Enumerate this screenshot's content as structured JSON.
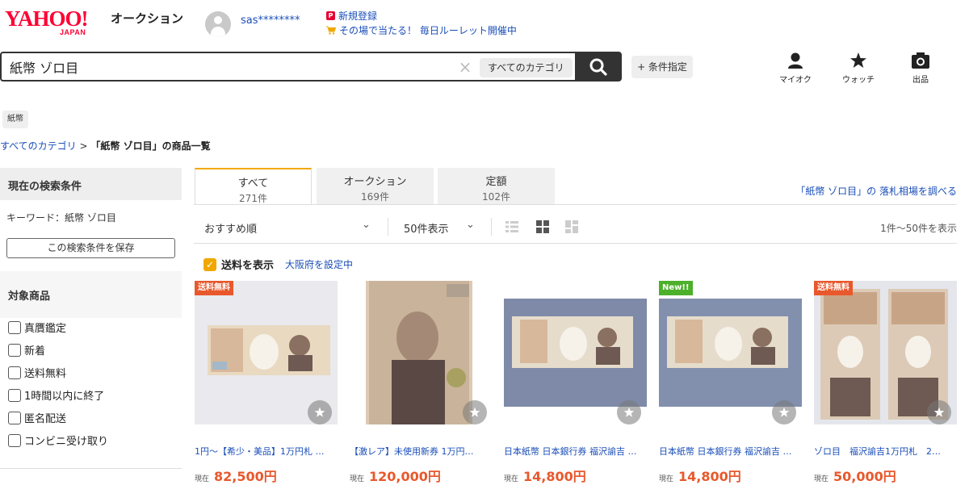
{
  "header": {
    "logo_yahoo": "YAHOO!",
    "logo_japan": "JAPAN",
    "service_name": "オークション",
    "username": "sas********",
    "promo_signup": "新規登録",
    "promo_roulette": "その場で当たる！ 毎日ルーレット開催中",
    "links": [
      {
        "label": "マイオク",
        "icon": "person-icon"
      },
      {
        "label": "ウォッチ",
        "icon": "star-icon"
      },
      {
        "label": "出品",
        "icon": "camera-icon"
      }
    ]
  },
  "search": {
    "query": "紙幣 ゾロ目",
    "category": "すべてのカテゴリ",
    "conditions_button": "+ 条件指定"
  },
  "tag_chip": "紙幣",
  "breadcrumb": {
    "root": "すべてのカテゴリ",
    "separator": ">",
    "current": "「紙幣 ゾロ目」の商品一覧"
  },
  "sidebar": {
    "current_conditions_title": "現在の検索条件",
    "keyword_text": "キーワード：紙幣 ゾロ目",
    "save_button": "この検索条件を保存",
    "target_title": "対象商品",
    "filters": [
      "真贋鑑定",
      "新着",
      "送料無料",
      "1時間以内に終了",
      "匿名配送",
      "コンビニ受け取り"
    ]
  },
  "tabs": [
    {
      "label": "すべて",
      "count": "271件"
    },
    {
      "label": "オークション",
      "count": "169件"
    },
    {
      "label": "定額",
      "count": "102件"
    }
  ],
  "market_link": "「紙幣 ゾロ目」の 落札相場を調べる",
  "sort": {
    "order": "おすすめ順",
    "per_page": "50件表示",
    "range": "1件〜50件を表示"
  },
  "shipping": {
    "label": "送料を表示",
    "location_link": "大阪府を設定中"
  },
  "products": [
    {
      "badge": "送料無料",
      "title": "1円〜【希少・美品】1万円札 …",
      "price_label": "現在",
      "price": "82,500円"
    },
    {
      "badge": "",
      "title": "【激レア】未使用新券 1万円…",
      "price_label": "現在",
      "price": "120,000円"
    },
    {
      "badge": "",
      "title": "日本紙幣 日本銀行券 福沢諭吉 …",
      "price_label": "現在",
      "price": "14,800円"
    },
    {
      "badge": "New!!",
      "title": "日本紙幣 日本銀行券 福沢諭吉 …",
      "price_label": "現在",
      "price": "14,800円"
    },
    {
      "badge": "送料無料",
      "title": "ゾロ目　福沢諭吉1万円札　2…",
      "price_label": "現在",
      "price": "50,000円"
    }
  ],
  "colors": {
    "brand_red": "#ff0033",
    "link_blue": "#1a4eb8",
    "price_orange": "#e8582c",
    "tab_accent": "#f0a800",
    "new_badge": "#4cb02a"
  }
}
